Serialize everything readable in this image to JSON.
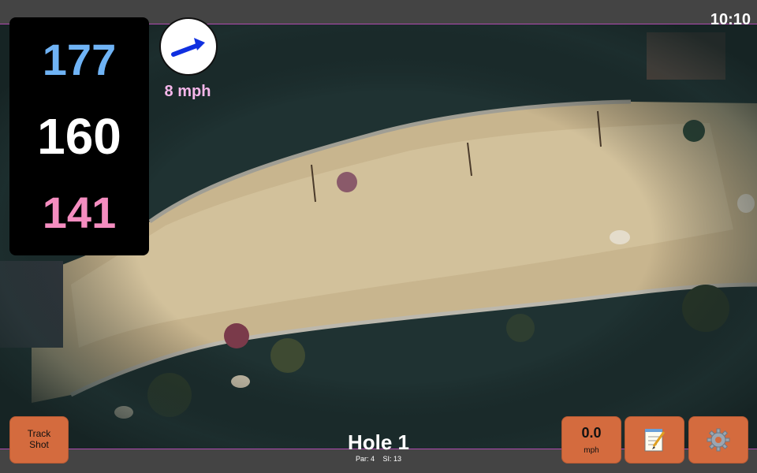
{
  "clock": "10:10",
  "distances": {
    "back": "177",
    "center": "160",
    "front": "141"
  },
  "wind": {
    "speed_label": "8 mph",
    "icon": "wind-arrow-icon"
  },
  "buttons": {
    "track_shot_label": "Track Shot",
    "speed_value": "0.0",
    "speed_unit": "mph",
    "notes_icon": "notepad-icon",
    "settings_icon": "gear-icon"
  },
  "hole": {
    "title": "Hole 1",
    "par": "Par: 4",
    "si": "SI: 13"
  },
  "colors": {
    "back": "#6fb3f5",
    "center": "#ffffff",
    "front": "#f58dc0",
    "button": "#d46b3e",
    "wind_label": "#f5b6ea",
    "map_border": "#b04ab0"
  }
}
